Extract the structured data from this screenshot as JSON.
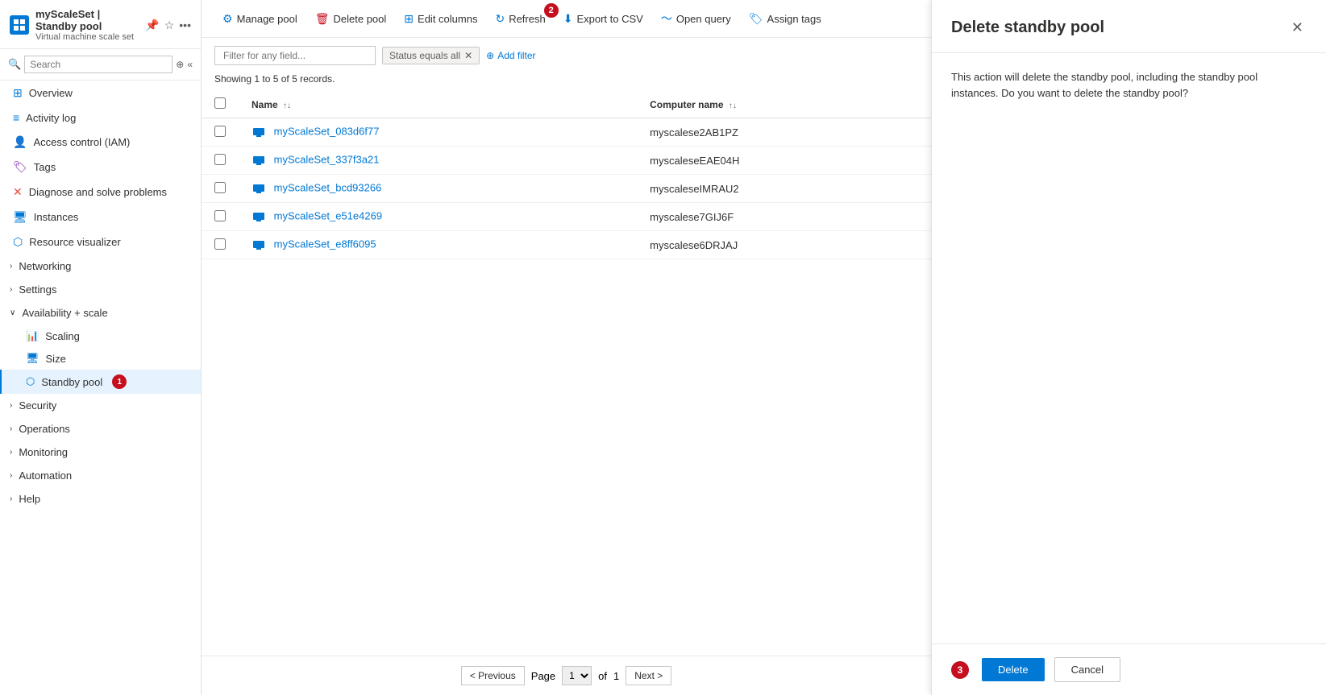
{
  "app": {
    "title": "myScaleSet | Standby pool",
    "subtitle": "Virtual machine scale set"
  },
  "sidebar": {
    "search_placeholder": "Search",
    "nav_items": [
      {
        "id": "overview",
        "label": "Overview",
        "icon": "grid"
      },
      {
        "id": "activity-log",
        "label": "Activity log",
        "icon": "list"
      },
      {
        "id": "access-control",
        "label": "Access control (IAM)",
        "icon": "person"
      },
      {
        "id": "tags",
        "label": "Tags",
        "icon": "tag"
      },
      {
        "id": "diagnose",
        "label": "Diagnose and solve problems",
        "icon": "wrench"
      },
      {
        "id": "instances",
        "label": "Instances",
        "icon": "monitor"
      },
      {
        "id": "resource-visualizer",
        "label": "Resource visualizer",
        "icon": "network"
      },
      {
        "id": "networking",
        "label": "Networking",
        "icon": "network",
        "expandable": true
      },
      {
        "id": "settings",
        "label": "Settings",
        "icon": "settings",
        "expandable": true
      },
      {
        "id": "availability-scale",
        "label": "Availability + scale",
        "icon": "expand",
        "expanded": true
      },
      {
        "id": "scaling",
        "label": "Scaling",
        "icon": "scale",
        "sub": true
      },
      {
        "id": "size",
        "label": "Size",
        "icon": "size",
        "sub": true
      },
      {
        "id": "standby-pool",
        "label": "Standby pool",
        "icon": "pool",
        "sub": true,
        "active": true,
        "badge": "1"
      },
      {
        "id": "security",
        "label": "Security",
        "icon": "shield",
        "expandable": true
      },
      {
        "id": "operations",
        "label": "Operations",
        "icon": "ops",
        "expandable": true
      },
      {
        "id": "monitoring",
        "label": "Monitoring",
        "icon": "chart",
        "expandable": true
      },
      {
        "id": "automation",
        "label": "Automation",
        "icon": "auto",
        "expandable": true
      },
      {
        "id": "help",
        "label": "Help",
        "icon": "help",
        "expandable": true
      }
    ]
  },
  "toolbar": {
    "manage_pool": "Manage pool",
    "delete_pool": "Delete pool",
    "edit_columns": "Edit columns",
    "refresh": "Refresh",
    "export_csv": "Export to CSV",
    "open_query": "Open query",
    "assign_tags": "Assign tags",
    "refresh_badge": "2"
  },
  "filter": {
    "placeholder": "Filter for any field...",
    "status_filter": "Status equals all",
    "add_filter": "Add filter"
  },
  "records": {
    "info": "Showing 1 to 5 of 5 records.",
    "col_name": "Name",
    "col_computer": "Computer name",
    "rows": [
      {
        "name": "myScaleSet_083d6f77",
        "computer": "myscalese2AB1PZ"
      },
      {
        "name": "myScaleSet_337f3a21",
        "computer": "myscaleseEAE04H"
      },
      {
        "name": "myScaleSet_bcd93266",
        "computer": "myscaleseIMRAU2"
      },
      {
        "name": "myScaleSet_e51e4269",
        "computer": "myscalese7GIJ6F"
      },
      {
        "name": "myScaleSet_e8ff6095",
        "computer": "myscalese6DRJAJ"
      }
    ]
  },
  "pagination": {
    "previous": "< Previous",
    "next": "Next >",
    "page_label": "Page",
    "of": "of",
    "total": "1",
    "current": "1"
  },
  "side_panel": {
    "title": "Delete standby pool",
    "description": "This action will delete the standby pool, including the standby pool instances. Do you want to delete the standby pool?",
    "delete_btn": "Delete",
    "cancel_btn": "Cancel",
    "badge": "3"
  }
}
